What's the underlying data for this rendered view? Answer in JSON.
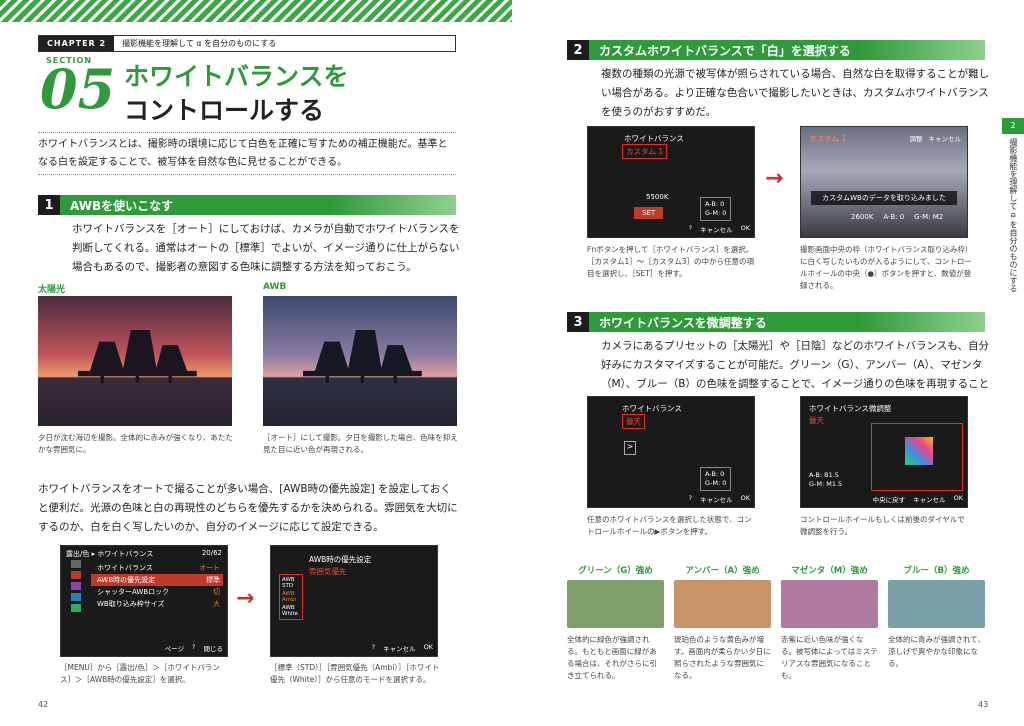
{
  "chapter": {
    "label": "CHAPTER 2",
    "title": "撮影機能を理解して α を自分のものにする"
  },
  "section": {
    "label": "SECTION",
    "number": "05",
    "title_line1": "ホワイトバランスを",
    "title_line2": "コントロールする"
  },
  "intro": "ホワイトバランスとは、撮影時の環境に応じて白色を正確に写すための補正機能だ。基準となる白を設定することで、被写体を自然な色に見せることができる。",
  "step1": {
    "num": "1",
    "title": "AWBを使いこなす",
    "body": "ホワイトバランスを［オート］にしておけば、カメラが自動でホワイトバランスを判断してくれる。通常はオートの［標準］でよいが、イメージ通りに仕上がらない場合もあるので、撮影者の意図する色味に調整する方法を知っておこう。"
  },
  "photos": {
    "left_label": "太陽光",
    "right_label": "AWB",
    "left_cap": "夕日が沈む海辺を撮影。全体的に赤みが強くなり、あたたかな雰囲気に。",
    "right_cap": "［オート］にして撮影。夕日を撮影した場合、色味を抑え見た目に近い色が再現される。"
  },
  "para2": "ホワイトバランスをオートで撮ることが多い場合、[AWB時の優先設定] を設定しておくと便利だ。光源の色味と白の再現性のどちらを優先するかを決められる。雰囲気を大切にするのか、白を白く写したいのか、自分のイメージに応じて設定できる。",
  "menu_screen": {
    "header": "露出/色",
    "title": "ホワイトバランス",
    "page": "20/62",
    "items": [
      {
        "label": "ホワイトバランス",
        "value": "オート"
      },
      {
        "label": "AWB時の優先設定",
        "value": "標準"
      },
      {
        "label": "シャッターAWBロック",
        "value": "切"
      },
      {
        "label": "WB取り込み枠サイズ",
        "value": "大"
      }
    ],
    "footer": [
      "ページ",
      "?",
      "閉じる"
    ]
  },
  "awb_screen": {
    "title": "AWB時の優先設定",
    "value": "雰囲気優先",
    "opts": [
      "AWB STD",
      "AWB Ambi",
      "AWB White"
    ],
    "footer": [
      "?",
      "キャンセル",
      "OK"
    ]
  },
  "cap_menu": "［MENU］から［露出/色］＞［ホワイトバランス］＞［AWB時の優先設定］を選択。",
  "cap_awb": "［標準（STD）］［雰囲気優先（Ambi）］［ホワイト優先（White）］から任意のモードを選択する。",
  "step2": {
    "num": "2",
    "title": "カスタムホワイトバランスで「白」を選択する",
    "body": "複数の種類の光源で被写体が照らされている場合、自然な白を取得することが難しい場合がある。より正確な色合いで撮影したいときは、カスタムホワイトバランスを使うのがおすすめだ。"
  },
  "wb_screen1": {
    "title": "ホワイトバランス",
    "value": "カスタム 1",
    "kelvin": "5500K",
    "set": "SET",
    "ab": "A-B: 0",
    "gm": "G-M: 0",
    "footer": [
      "?",
      "キャンセル",
      "OK"
    ]
  },
  "wb_screen2": {
    "title": "カスタム 1",
    "btn": "調整",
    "cancel": "キャンセル",
    "msg": "カスタムWBのデータを取り込みました",
    "kelvin": "2600K",
    "ab": "A-B: 0",
    "gm": "G-M: M2"
  },
  "cap2a": "Fnボタンを押して［ホワイトバランス］を選択。［カスタム1］～［カスタム3］の中から任意の項目を選択し、［SET］を押す。",
  "cap2b": "撮影画面中央の枠（ホワイトバランス取り込み枠）に白く写したいものが入るようにして、コントロールホイールの中央（●）ボタンを押すと、数値が登録される。",
  "step3": {
    "num": "3",
    "title": "ホワイトバランスを微調整する",
    "body": "カメラにあるプリセットの［太陽光］や［日陰］などのホワイトバランスも、自分好みにカスタマイズすることが可能だ。グリーン（G）、アンバー（A）、マゼンタ（M）、ブルー（B）の色味を調整することで、イメージ通りの色味を再現することができる。"
  },
  "wb_screen3": {
    "title": "ホワイトバランス",
    "value": "曇天",
    "ab": "A-B: 0",
    "gm": "G-M: 0",
    "footer": [
      "?",
      "キャンセル",
      "OK"
    ]
  },
  "wb_screen4": {
    "title": "ホワイトバランス微調整",
    "value": "曇天",
    "ab": "A-B: B1.5",
    "gm": "G-M: M1.5",
    "footer": [
      "中央に戻す",
      "キャンセル",
      "OK"
    ]
  },
  "cap3a": "任意のホワイトバランスを選択した状態で、コントロールホイールの▶ボタンを押す。",
  "cap3b": "コントロールホイールもしくは前後のダイヤルで微調整を行う。",
  "swatches": [
    {
      "label": "グリーン（G）強め",
      "cap": "全体的に緑色が強調される。もともと画面に緑がある場合は、それがさらに引き立てられる。",
      "color": "#7fa06a"
    },
    {
      "label": "アンバー（A）強め",
      "cap": "琥珀色のような黄色みが増す。画面内が柔らかい夕日に照らされたような雰囲気になる。",
      "color": "#c8946a"
    },
    {
      "label": "マゼンタ（M）強め",
      "cap": "赤紫に近い色味が強くなる。被写体によってはミステリアスな雰囲気になることも。",
      "color": "#b07aa0"
    },
    {
      "label": "ブルー（B）強め",
      "cap": "全体的に青みが強調されて、涼しげで爽やかな印象になる。",
      "color": "#7aa0a8"
    }
  ],
  "pages": {
    "left": "42",
    "right": "43"
  },
  "side": {
    "tab": "2",
    "text": "撮影機能を理解して α を自分のものにする"
  }
}
